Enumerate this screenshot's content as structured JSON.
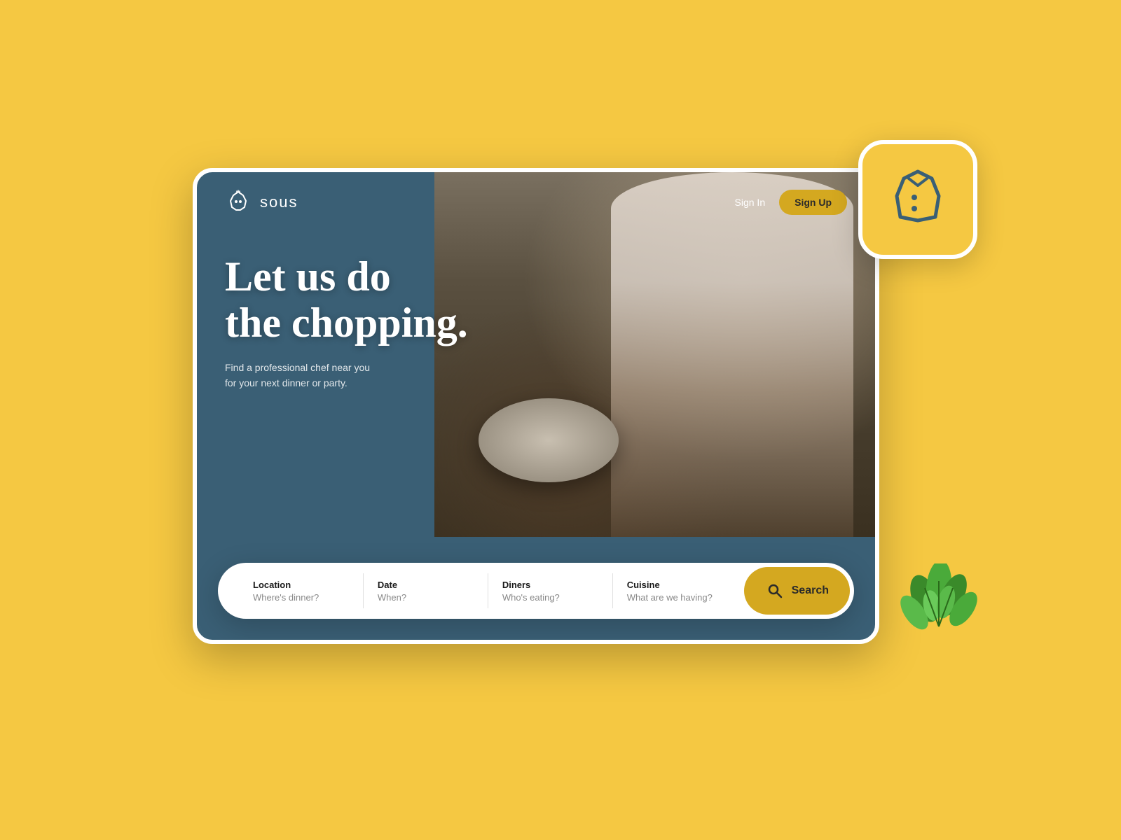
{
  "background_color": "#F5C842",
  "navbar": {
    "logo_text": "sous",
    "sign_in_label": "Sign In",
    "sign_up_label": "Sign Up"
  },
  "hero": {
    "title_line1": "Let us do",
    "title_line2": "the chopping.",
    "subtitle_line1": "Find a professional chef near you",
    "subtitle_line2": "for your next dinner or party."
  },
  "search_bar": {
    "fields": [
      {
        "label": "Location",
        "placeholder": "Where's dinner?"
      },
      {
        "label": "Date",
        "placeholder": "When?"
      },
      {
        "label": "Diners",
        "placeholder": "Who's eating?"
      },
      {
        "label": "Cuisine",
        "placeholder": "What are we having?"
      }
    ],
    "search_button_label": "Search"
  },
  "colors": {
    "primary_bg": "#3a5f75",
    "accent": "#D4A820",
    "white": "#ffffff",
    "text_dark": "#1a1a1a",
    "placeholder": "#888888"
  }
}
